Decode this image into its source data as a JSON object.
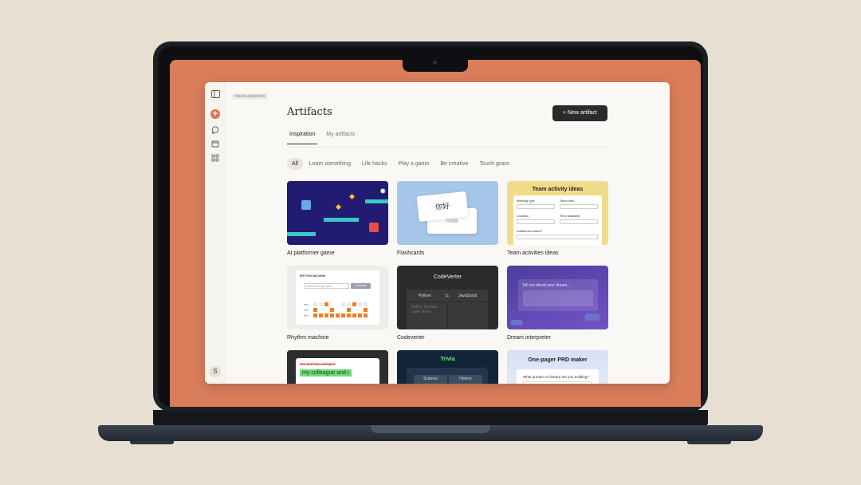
{
  "app": {
    "url": "claude.ai/artifacts",
    "title": "Artifacts",
    "new_button": "New artifact",
    "avatar_initial": "S",
    "tabs": [
      {
        "label": "Inspiration",
        "active": true
      },
      {
        "label": "My artifacts",
        "active": false
      }
    ],
    "chips": [
      {
        "label": "All",
        "active": true
      },
      {
        "label": "Learn something"
      },
      {
        "label": "Life hacks"
      },
      {
        "label": "Play a game"
      },
      {
        "label": "Be creative"
      },
      {
        "label": "Touch grass"
      }
    ],
    "cards": {
      "game": "AI platformer game",
      "flash": "Flashcards",
      "team": "Team activities ideas",
      "rhythm": "Rhythm machine",
      "code": "Codeverter",
      "dream": "Dream interpreter"
    },
    "thumbs": {
      "flash_front": "你好",
      "flash_back": "hola",
      "team_title": "Team activity ideas",
      "team_fields": [
        "Meeting type",
        "Team size",
        "Location",
        "Time available",
        "Additional context"
      ],
      "rhythm_title": "RHYTHM MACHINE",
      "rhythm_input": "ambient lounge beat",
      "rhythm_btn": "Generate",
      "code_title": "CodeVerter",
      "code_from": "Python",
      "code_to": "JavaScript",
      "code_placeholder": "Enter Python code here...",
      "dream_prompt": "Tell me about your dream...",
      "memo_struck": "me and my collegue",
      "memo_fixed": "my colleague and I",
      "trivia_title": "Trivia",
      "trivia_opts": [
        "Science",
        "History"
      ],
      "prd_title": "One-pager PRD maker",
      "prd_q": "What product or feature are you building?"
    }
  },
  "colors": {
    "screen_bg": "#d97d5b",
    "page_bg": "#e6dfd2",
    "accent": "#d97757",
    "button_dark": "#2b2b2b"
  }
}
